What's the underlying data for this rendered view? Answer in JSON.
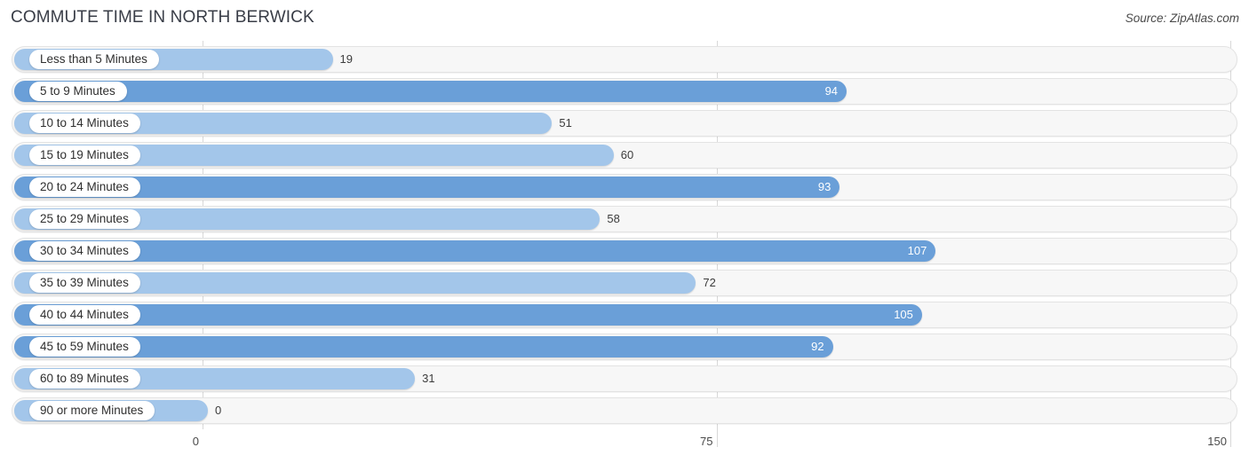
{
  "header": {
    "title": "COMMUTE TIME IN NORTH BERWICK",
    "source": "Source: ZipAtlas.com"
  },
  "colors": {
    "bar_light": "#a3c6ea",
    "bar_dark": "#6a9fd8",
    "track_fill": "#f7f7f7",
    "track_border": "#e3e3e3",
    "gridline": "#d8d8d8",
    "title_text": "#393d47",
    "value_text": "#3c3c3c",
    "value_text_inside": "#ffffff"
  },
  "chart_data": {
    "type": "bar",
    "orientation": "horizontal",
    "title": "COMMUTE TIME IN NORTH BERWICK",
    "xlabel": "",
    "ylabel": "",
    "xlim": [
      0,
      150
    ],
    "ticks": [
      "0",
      "75",
      "150"
    ],
    "tick_values": [
      0,
      75,
      150
    ],
    "grid": true,
    "legend": null,
    "categories": [
      "Less than 5 Minutes",
      "5 to 9 Minutes",
      "10 to 14 Minutes",
      "15 to 19 Minutes",
      "20 to 24 Minutes",
      "25 to 29 Minutes",
      "30 to 34 Minutes",
      "35 to 39 Minutes",
      "40 to 44 Minutes",
      "45 to 59 Minutes",
      "60 to 89 Minutes",
      "90 or more Minutes"
    ],
    "values": [
      19,
      94,
      51,
      60,
      93,
      58,
      107,
      72,
      105,
      92,
      31,
      0
    ],
    "value_labels": [
      "19",
      "94",
      "51",
      "60",
      "93",
      "58",
      "107",
      "72",
      "105",
      "92",
      "31",
      "0"
    ],
    "bar_shades": [
      "light",
      "dark",
      "light",
      "light",
      "dark",
      "light",
      "dark",
      "light",
      "dark",
      "dark",
      "light",
      "light"
    ],
    "label_inside": [
      false,
      true,
      false,
      false,
      true,
      false,
      true,
      false,
      true,
      true,
      false,
      false
    ]
  }
}
